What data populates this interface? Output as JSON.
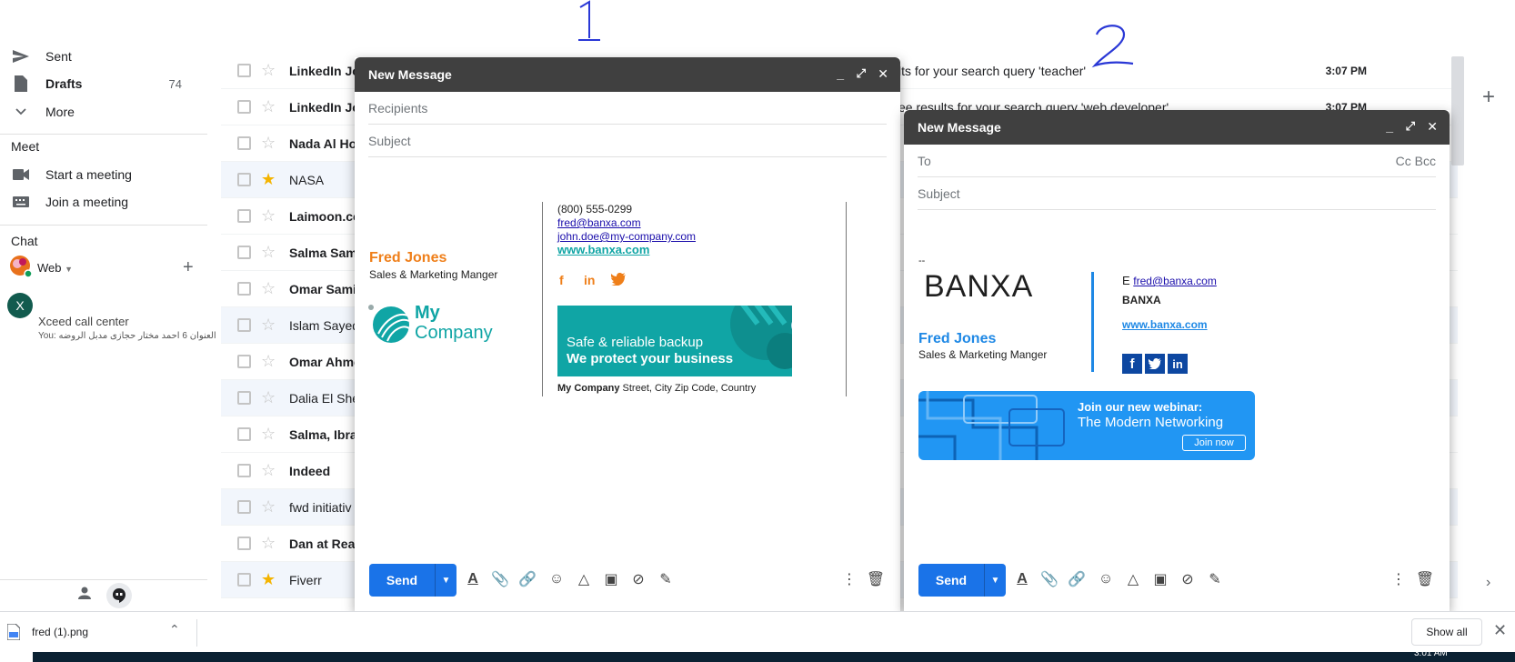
{
  "annotations": {
    "one": "1",
    "two": "2"
  },
  "sidebar": {
    "items": [
      {
        "label": "Sent",
        "count": ""
      },
      {
        "label": "Drafts",
        "count": "74"
      },
      {
        "label": "More",
        "count": ""
      }
    ],
    "meet": {
      "heading": "Meet",
      "start": "Start a meeting",
      "join": "Join a meeting"
    },
    "chat": {
      "heading": "Chat",
      "status": "Web",
      "contact_initial": "X",
      "contact_name": "Xceed call center",
      "contact_preview": "You: العنوان 6 احمد مختار حجازى مدبل الروضه"
    }
  },
  "email_list": [
    {
      "sender": "LinkedIn Jo",
      "subject": "lts for your search query 'teacher'",
      "time": "3:07 PM",
      "bold": true,
      "starred": false
    },
    {
      "sender": "LinkedIn Jo",
      "subject": "ee results for your search query 'web developer'",
      "time": "3:07 PM",
      "bold": true,
      "starred": false
    },
    {
      "sender": "Nada Al Ho",
      "subject": "",
      "time": "",
      "bold": true,
      "starred": false
    },
    {
      "sender": "NASA",
      "subject": "",
      "time": "",
      "bold": false,
      "starred": true
    },
    {
      "sender": "Laimoon.co",
      "subject": "",
      "time": "",
      "bold": true,
      "starred": false
    },
    {
      "sender": "Salma Sam",
      "subject": "",
      "time": "",
      "bold": true,
      "starred": false
    },
    {
      "sender": "Omar Sami",
      "subject": "",
      "time": "",
      "bold": true,
      "starred": false
    },
    {
      "sender": "Islam Sayed",
      "subject": "",
      "time": "",
      "bold": false,
      "starred": false
    },
    {
      "sender": "Omar Ahme",
      "subject": "",
      "time": "",
      "bold": true,
      "starred": false
    },
    {
      "sender": "Dalia El She",
      "subject": "",
      "time": "",
      "bold": false,
      "starred": false
    },
    {
      "sender": "Salma, Ibra",
      "subject": "",
      "time": "",
      "bold": true,
      "starred": false
    },
    {
      "sender": "Indeed",
      "subject": "",
      "time": "",
      "bold": true,
      "starred": false
    },
    {
      "sender": "fwd initiativ",
      "subject": "",
      "time": "",
      "bold": false,
      "starred": false
    },
    {
      "sender": "Dan at Real",
      "subject": "",
      "time": "",
      "bold": true,
      "starred": false
    },
    {
      "sender": "Fiverr",
      "subject": "",
      "time": "",
      "bold": false,
      "starred": true
    }
  ],
  "compose1": {
    "title": "New Message",
    "recipients_placeholder": "Recipients",
    "subject_placeholder": "Subject",
    "send": "Send",
    "signature": {
      "name": "Fred Jones",
      "role": "Sales & Marketing Manger",
      "logo_line1": "My",
      "logo_line2": "Company",
      "phone": "(800) 555-0299",
      "email1": "fred@banxa.com",
      "email2": "john.doe@my-company.com",
      "website": "www.banxa.com",
      "banner_line1": "Safe & reliable backup",
      "banner_line2": "We protect your business",
      "company": "My Company",
      "address": "Street, City Zip Code, Country"
    }
  },
  "compose2": {
    "title": "New Message",
    "to_placeholder": "To",
    "cc_bcc": "Cc Bcc",
    "subject_placeholder": "Subject",
    "send": "Send",
    "signature": {
      "dashes": "--",
      "logo": "BANXA",
      "name": "Fred Jones",
      "role": "Sales & Marketing Manger",
      "email_prefix": "E",
      "email": "fred@banxa.com",
      "company": "BANXA",
      "website": "www.banxa.com",
      "banner_line1": "Join our new webinar:",
      "banner_line2": "The Modern Networking",
      "banner_button": "Join now"
    }
  },
  "download_bar": {
    "filename": "fred (1).png",
    "show_all": "Show all"
  },
  "taskbar": {
    "clock": "3:01 AM"
  },
  "colors": {
    "accent": "#1a73e8",
    "header": "#404040",
    "orange": "#ef7f1a",
    "teal": "#10a5a5",
    "banner_blue": "#2196f3"
  }
}
